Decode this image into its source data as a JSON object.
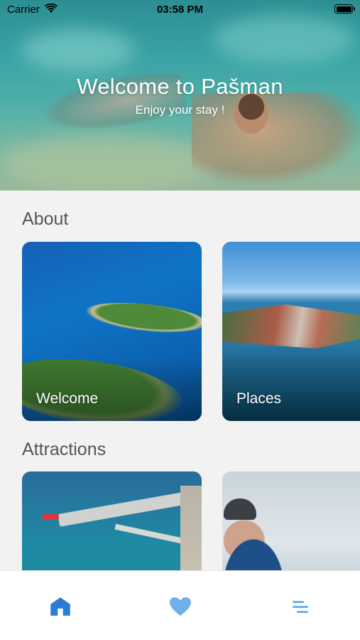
{
  "status_bar": {
    "carrier": "Carrier",
    "time": "03:58 PM"
  },
  "hero": {
    "title": "Welcome to Pašman",
    "subtitle": "Enjoy your stay !"
  },
  "sections": {
    "about": {
      "title": "About",
      "cards": [
        {
          "label": "Welcome"
        },
        {
          "label": "Places"
        }
      ]
    },
    "attractions": {
      "title": "Attractions",
      "cards": [
        {
          "label": ""
        },
        {
          "label": ""
        }
      ]
    }
  },
  "tabbar": {
    "items": [
      {
        "icon": "home-icon",
        "active": true
      },
      {
        "icon": "heart-icon",
        "active": false
      },
      {
        "icon": "menu-icon",
        "active": false
      }
    ],
    "accent_color": "#2a7dd4",
    "inactive_color": "#6fb0ea"
  }
}
